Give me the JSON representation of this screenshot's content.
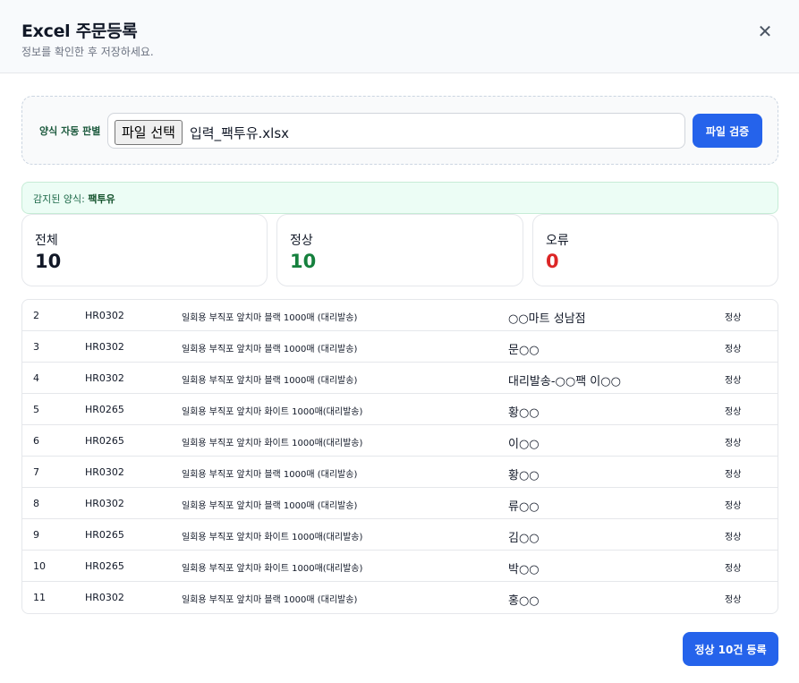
{
  "header": {
    "title": "Excel 주문등록",
    "subtitle": "정보를 확인한 후 저장하세요.",
    "close_label": "✕"
  },
  "upload": {
    "label": "양식 자동 판별",
    "file_button_label": "파일 선택",
    "file_name": "입력_팩투유.xlsx",
    "validate_label": "파일 검증"
  },
  "detected": {
    "prefix": "감지된 양식: ",
    "format": "팩투유"
  },
  "stats": {
    "total": {
      "label": "전체",
      "value": "10",
      "color": "#111827"
    },
    "normal": {
      "label": "정상",
      "value": "10",
      "color": "#15803d"
    },
    "error": {
      "label": "오류",
      "value": "0",
      "color": "#dc2626"
    }
  },
  "rows": [
    {
      "no": "2",
      "code": "HR0302",
      "product": "일회용 부직포 앞치마 블랙 1000매 (대리발송)",
      "customer": "○○마트 성남점",
      "status": "정상"
    },
    {
      "no": "3",
      "code": "HR0302",
      "product": "일회용 부직포 앞치마 블랙 1000매 (대리발송)",
      "customer": "문○○",
      "status": "정상"
    },
    {
      "no": "4",
      "code": "HR0302",
      "product": "일회용 부직포 앞치마 블랙 1000매 (대리발송)",
      "customer": "대리발송-○○팩 이○○",
      "status": "정상"
    },
    {
      "no": "5",
      "code": "HR0265",
      "product": "일회용 부직포 앞치마 화이트 1000매(대리발송)",
      "customer": "황○○",
      "status": "정상"
    },
    {
      "no": "6",
      "code": "HR0265",
      "product": "일회용 부직포 앞치마 화이트 1000매(대리발송)",
      "customer": "이○○",
      "status": "정상"
    },
    {
      "no": "7",
      "code": "HR0302",
      "product": "일회용 부직포 앞치마 블랙 1000매 (대리발송)",
      "customer": "황○○",
      "status": "정상"
    },
    {
      "no": "8",
      "code": "HR0302",
      "product": "일회용 부직포 앞치마 블랙 1000매 (대리발송)",
      "customer": "류○○",
      "status": "정상"
    },
    {
      "no": "9",
      "code": "HR0265",
      "product": "일회용 부직포 앞치마 화이트 1000매(대리발송)",
      "customer": "김○○",
      "status": "정상"
    },
    {
      "no": "10",
      "code": "HR0265",
      "product": "일회용 부직포 앞치마 화이트 1000매(대리발송)",
      "customer": "박○○",
      "status": "정상"
    },
    {
      "no": "11",
      "code": "HR0302",
      "product": "일회용 부직포 앞치마 블랙 1000매 (대리발송)",
      "customer": "홍○○",
      "status": "정상"
    }
  ],
  "footer": {
    "submit_label": "정상 10건 등록"
  },
  "colors": {
    "accent": "#2563eb",
    "success": "#15803d",
    "error": "#dc2626"
  }
}
